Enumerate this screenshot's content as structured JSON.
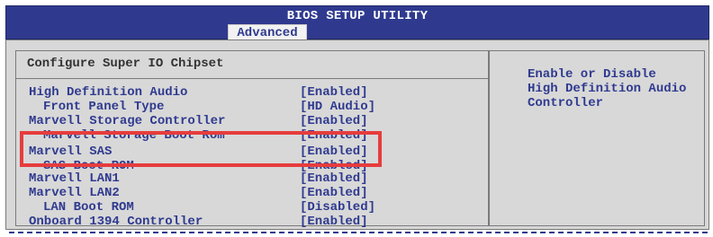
{
  "header": {
    "title": "BIOS SETUP UTILITY",
    "active_tab": "Advanced"
  },
  "section": {
    "title": "Configure Super IO Chipset"
  },
  "settings": [
    {
      "label": "High Definition Audio",
      "value": "[Enabled]",
      "indent": false
    },
    {
      "label": "Front Panel Type",
      "value": "[HD Audio]",
      "indent": true
    },
    {
      "label": "Marvell Storage Controller",
      "value": "[Enabled]",
      "indent": false
    },
    {
      "label": "Marvell Storage Boot Rom",
      "value": "[Enabled]",
      "indent": true
    },
    {
      "label": "Marvell SAS",
      "value": "[Enabled]",
      "indent": false
    },
    {
      "label": "SAS Boot ROM",
      "value": "[Enabled]",
      "indent": true
    },
    {
      "label": "Marvell LAN1",
      "value": "[Enabled]",
      "indent": false
    },
    {
      "label": "Marvell LAN2",
      "value": "[Enabled]",
      "indent": false
    },
    {
      "label": "LAN Boot ROM",
      "value": "[Disabled]",
      "indent": true
    },
    {
      "label": "Onboard 1394 Controller",
      "value": "[Enabled]",
      "indent": false
    }
  ],
  "help": {
    "lines": [
      "Enable or Disable",
      "High Definition Audio",
      "Controller"
    ]
  },
  "colors": {
    "header_bg": "#2f3a8f",
    "panel_bg": "#d8d8d8",
    "text_blue": "#2f3a8f",
    "highlight_red": "#e63d3d"
  }
}
